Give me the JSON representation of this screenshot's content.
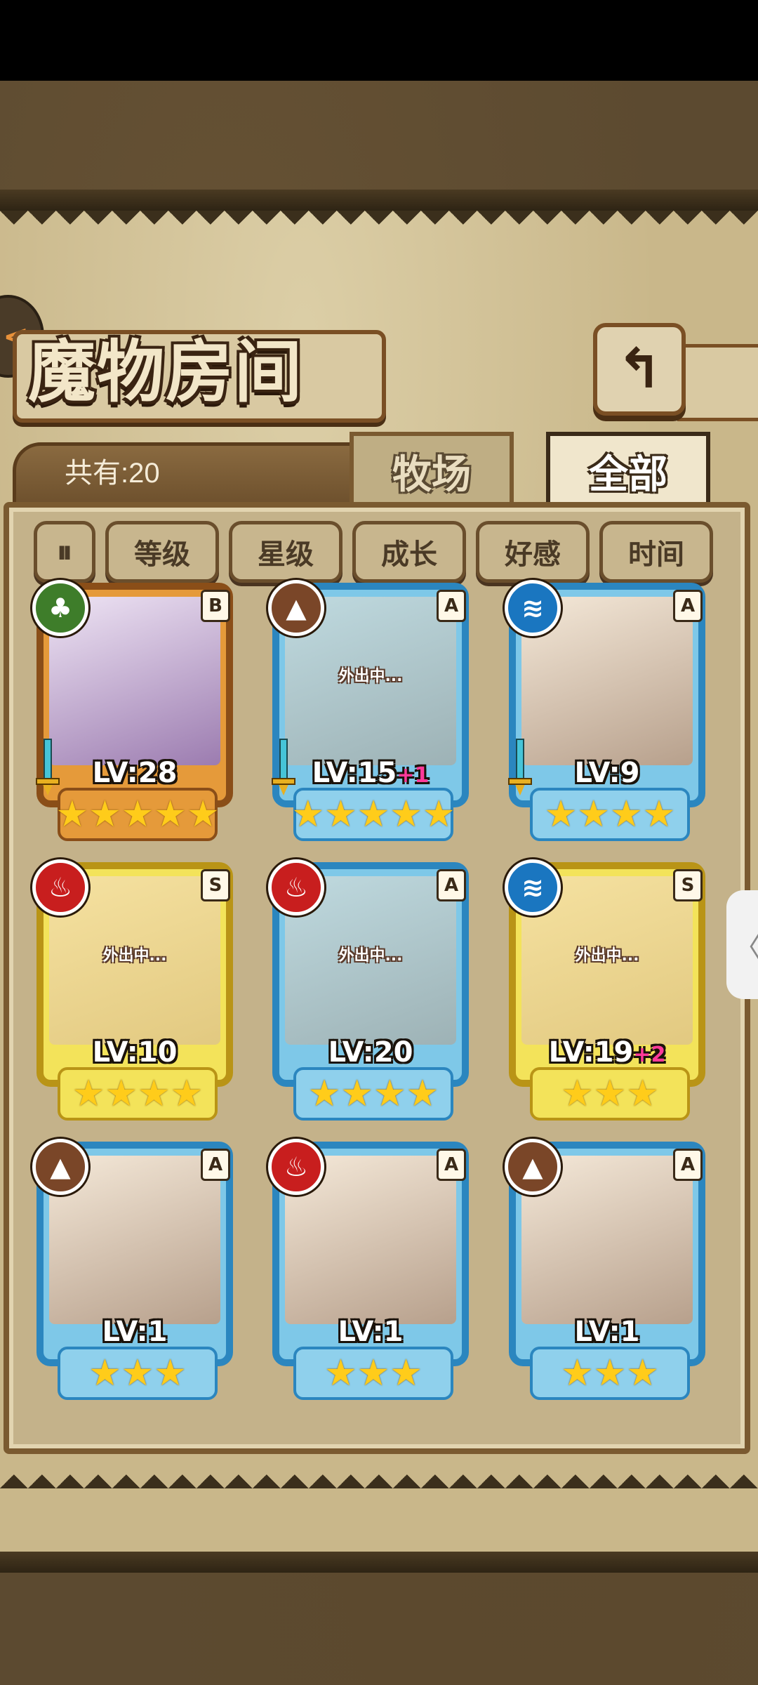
{
  "header": {
    "title": "魔物房间"
  },
  "count": {
    "label": "共有:20"
  },
  "tabs": [
    {
      "label": "牧场",
      "active": false
    },
    {
      "label": "全部",
      "active": true
    }
  ],
  "filters": {
    "sort_icon": "sort-order-icon",
    "buttons": [
      "等级",
      "星级",
      "成长",
      "好感",
      "时间"
    ]
  },
  "away_text": "外出中...",
  "monsters": [
    {
      "element": "grass",
      "rank": "B",
      "level": "LV:28",
      "plus": "",
      "stars": "★★★★★",
      "away": false,
      "weapon": true
    },
    {
      "element": "earth",
      "rank": "A",
      "level": "LV:15",
      "plus": "+1",
      "stars": "★★★★★",
      "away": true,
      "weapon": true
    },
    {
      "element": "water",
      "rank": "A",
      "level": "LV:9",
      "plus": "",
      "stars": "★★★★",
      "away": false,
      "weapon": true
    },
    {
      "element": "fire",
      "rank": "S",
      "level": "LV:10",
      "plus": "",
      "stars": "★★★★",
      "away": true,
      "weapon": false
    },
    {
      "element": "fire",
      "rank": "A",
      "level": "LV:20",
      "plus": "",
      "stars": "★★★★",
      "away": true,
      "weapon": false
    },
    {
      "element": "water",
      "rank": "S",
      "level": "LV:19",
      "plus": "+2",
      "stars": "★★★",
      "away": true,
      "weapon": false
    },
    {
      "element": "earth",
      "rank": "A",
      "level": "LV:1",
      "plus": "",
      "stars": "★★★",
      "away": false,
      "weapon": false
    },
    {
      "element": "fire",
      "rank": "A",
      "level": "LV:1",
      "plus": "",
      "stars": "★★★",
      "away": false,
      "weapon": false
    },
    {
      "element": "earth",
      "rank": "A",
      "level": "LV:1",
      "plus": "",
      "stars": "★★★",
      "away": false,
      "weapon": false
    }
  ],
  "colors": {
    "rank_A": "#2b86bf",
    "rank_S": "#b99416",
    "rank_B": "#8a4e18",
    "fire": "#c81e1e",
    "water": "#1a76c0",
    "grass": "#3e7d2a",
    "earth": "#7a4628",
    "plus": "#ff3a9a",
    "star": "#ffcc1a"
  }
}
